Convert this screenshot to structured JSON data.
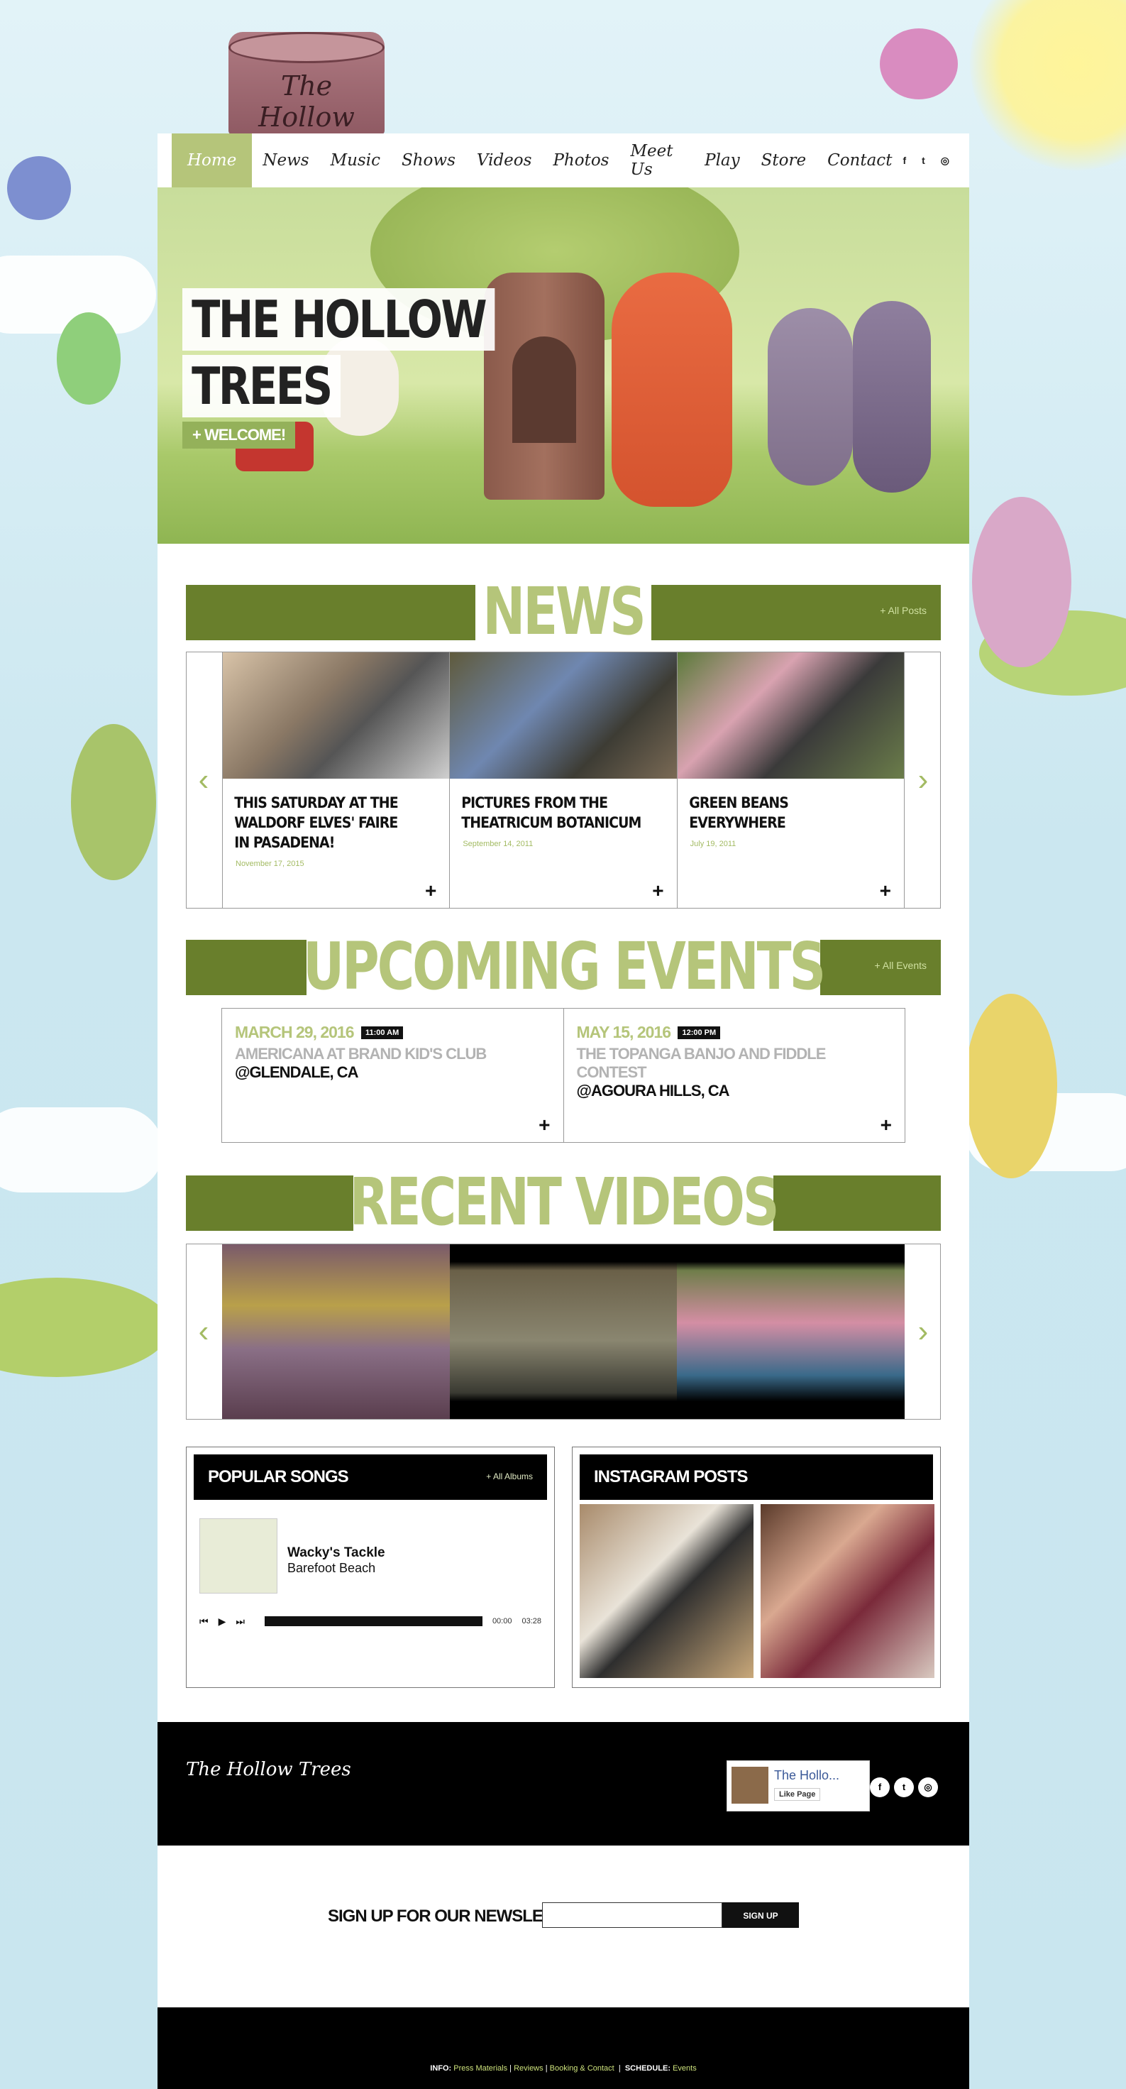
{
  "brand": {
    "stump_logo": "The Hollow Trees",
    "accent": "#b5c57a",
    "dark_green": "#697f2c"
  },
  "nav": {
    "items": [
      "Home",
      "News",
      "Music",
      "Shows",
      "Videos",
      "Photos",
      "Meet Us",
      "Play",
      "Store",
      "Contact"
    ],
    "active": "Home",
    "social": [
      {
        "icon": "facebook-icon",
        "glyph": "f"
      },
      {
        "icon": "twitter-icon",
        "glyph": "t"
      },
      {
        "icon": "instagram-icon",
        "glyph": "◎"
      }
    ]
  },
  "hero": {
    "title_line1": "THE HOLLOW",
    "title_line2": "TREES",
    "button": "+ WELCOME!"
  },
  "news": {
    "heading": "NEWS",
    "more": "+ All Posts",
    "posts": [
      {
        "title": "THIS SATURDAY AT THE WALDORF ELVES' FAIRE IN PASADENA!",
        "date": "November 17, 2015"
      },
      {
        "title": "PICTURES FROM THE THEATRICUM BOTANICUM",
        "date": "September 14, 2011"
      },
      {
        "title": "GREEN BEANS EVERYWHERE",
        "date": "July 19, 2011"
      }
    ]
  },
  "events": {
    "heading": "UPCOMING EVENTS",
    "more": "+ All Events",
    "items": [
      {
        "date": "MARCH 29, 2016",
        "time": "11:00 AM",
        "name": "AMERICANA AT BRAND KID'S CLUB",
        "place": "@GLENDALE, CA"
      },
      {
        "date": "MAY 15, 2016",
        "time": "12:00 PM",
        "name": "THE TOPANGA BANJO AND FIDDLE CONTEST",
        "place": "@AGOURA HILLS, CA"
      }
    ]
  },
  "videos": {
    "heading": "RECENT VIDEOS"
  },
  "songs": {
    "heading": "POPULAR SONGS",
    "more": "+ All Albums",
    "track": "Wacky's Tackle",
    "album": "Barefoot Beach",
    "elapsed": "00:00",
    "duration": "03:28"
  },
  "instagram": {
    "heading": "INSTAGRAM POSTS"
  },
  "footer": {
    "logo": "The Hollow Trees",
    "fb_name": "The Hollo...",
    "fb_like": "Like Page",
    "social": [
      {
        "icon": "facebook-icon",
        "glyph": "f"
      },
      {
        "icon": "twitter-icon",
        "glyph": "t"
      },
      {
        "icon": "instagram-icon",
        "glyph": "◎"
      }
    ]
  },
  "newsletter": {
    "label": "SIGN UP FOR OUR NEWSLETTER",
    "button": "SIGN UP"
  },
  "bottom": {
    "info_label": "INFO:",
    "links": [
      "Press Materials",
      "Reviews",
      "Booking & Contact"
    ],
    "schedule_label": "SCHEDULE:",
    "schedule_link": "Events"
  }
}
